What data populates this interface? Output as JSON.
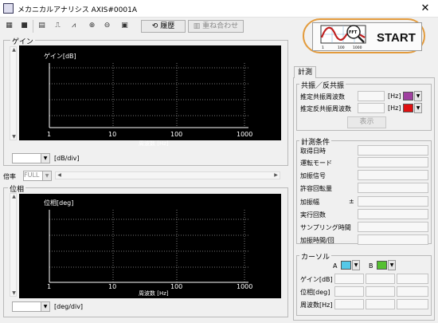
{
  "window": {
    "title": "メカニカルアナリシス AXIS#0001A",
    "close": "✕"
  },
  "toolbar": {
    "history_label": "履歴",
    "overlay_label": "重ね合わせ",
    "start_label": "START"
  },
  "gain_panel": {
    "title": "ゲイン",
    "y_label": "ゲイン[dB]",
    "x_label": "周波数 [Hz]",
    "x_ticks": [
      "1",
      "10",
      "100",
      "1000"
    ],
    "unit_select": {
      "value": "",
      "suffix": "[dB/div]"
    }
  },
  "magnification": {
    "label": "倍率",
    "value": "FULL"
  },
  "phase_panel": {
    "title": "位相",
    "y_label": "位相[deg]",
    "x_label": "周波数 [Hz]",
    "x_ticks": [
      "1",
      "10",
      "100",
      "1000"
    ],
    "unit_select": {
      "value": "",
      "suffix": "[deg/div]"
    }
  },
  "right_panel": {
    "tab_label": "計測",
    "resonance": {
      "title": "共振／反共振",
      "rows": [
        {
          "label": "推定共振周波数",
          "unit": "[Hz]",
          "color": "#a040a0"
        },
        {
          "label": "推定反共振周波数",
          "unit": "[Hz]",
          "color": "#e01010"
        }
      ],
      "display_button": "表示"
    },
    "conditions": {
      "title": "計測条件",
      "rows": [
        "取得日時",
        "運転モード",
        "加振信号",
        "許容回転量",
        "加振幅",
        "実行回数",
        "サンプリング時間",
        "加振時間/回"
      ],
      "amplitude_symbol": "±"
    },
    "cursor": {
      "title": "カーソル",
      "a_label": "A",
      "b_label": "B",
      "a_color": "#55c8e8",
      "b_color": "#55c030",
      "rows": [
        "ゲイン[dB]",
        "位相[deg]",
        "周波数[Hz]"
      ]
    }
  },
  "start_graphic": {
    "badge": "FFT",
    "x_ticks": [
      "1",
      "100",
      "1000"
    ]
  }
}
